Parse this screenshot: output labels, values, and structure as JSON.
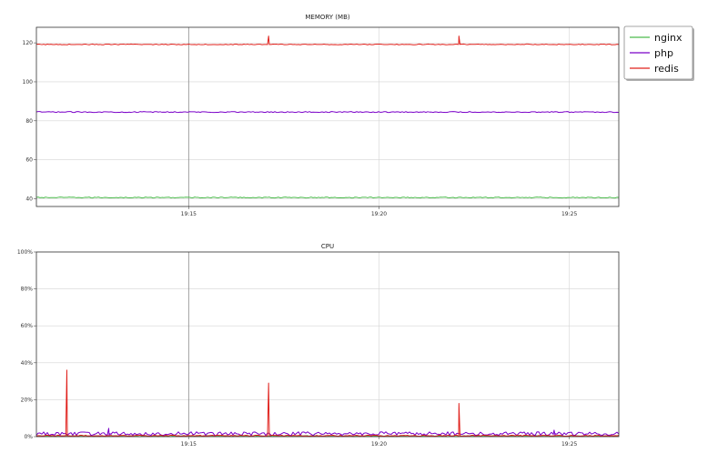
{
  "chart_data": [
    {
      "type": "line",
      "title": "MEMORY (MB)",
      "xlabel": "",
      "ylabel": "",
      "x_ticks": [
        "19:15",
        "19:20",
        "19:25"
      ],
      "x_tick_minutes": [
        15,
        20,
        25
      ],
      "xlim_minutes": [
        11.0,
        26.3
      ],
      "y_ticks": [
        40,
        60,
        80,
        100,
        120
      ],
      "y_tick_labels": [
        "40",
        "60",
        "80",
        "100",
        "120"
      ],
      "ylim": [
        36,
        128
      ],
      "grid": true,
      "series": [
        {
          "name": "nginx",
          "color": "#4cbb4c",
          "base": 40.6,
          "noise": 0.25,
          "spikes": []
        },
        {
          "name": "php",
          "color": "#7a00c8",
          "base": 84.5,
          "noise": 0.25,
          "spikes": []
        },
        {
          "name": "redis",
          "color": "#e0201b",
          "base": 119.2,
          "noise": 0.2,
          "spikes": [
            {
              "x_minutes": 17.1,
              "value": 123.5
            },
            {
              "x_minutes": 22.1,
              "value": 123.5
            }
          ]
        }
      ]
    },
    {
      "type": "line",
      "title": "CPU",
      "xlabel": "",
      "ylabel": "",
      "x_ticks": [
        "19:15",
        "19:20",
        "19:25"
      ],
      "x_tick_minutes": [
        15,
        20,
        25
      ],
      "xlim_minutes": [
        11.0,
        26.3
      ],
      "y_ticks": [
        0,
        20,
        40,
        60,
        80,
        100
      ],
      "y_tick_labels": [
        "0%",
        "20%",
        "40%",
        "60%",
        "80%",
        "100%"
      ],
      "ylim": [
        0,
        100
      ],
      "grid": true,
      "series": [
        {
          "name": "nginx",
          "color": "#4cbb4c",
          "base": 0.3,
          "noise": 0.3,
          "spikes": []
        },
        {
          "name": "php",
          "color": "#7a00c8",
          "base": 1.6,
          "noise": 1.0,
          "spikes": [
            {
              "x_minutes": 12.9,
              "value": 4.5
            },
            {
              "x_minutes": 24.6,
              "value": 3.5
            }
          ]
        },
        {
          "name": "redis",
          "color": "#e0201b",
          "base": 0.5,
          "noise": 0.3,
          "spikes": [
            {
              "x_minutes": 11.8,
              "value": 36
            },
            {
              "x_minutes": 17.1,
              "value": 29
            },
            {
              "x_minutes": 22.1,
              "value": 18
            }
          ]
        }
      ]
    }
  ],
  "legend": {
    "placement": "top-right",
    "entries": [
      {
        "name": "nginx",
        "color": "#4cbb4c"
      },
      {
        "name": "php",
        "color": "#7a00c8"
      },
      {
        "name": "redis",
        "color": "#e0201b"
      }
    ]
  }
}
